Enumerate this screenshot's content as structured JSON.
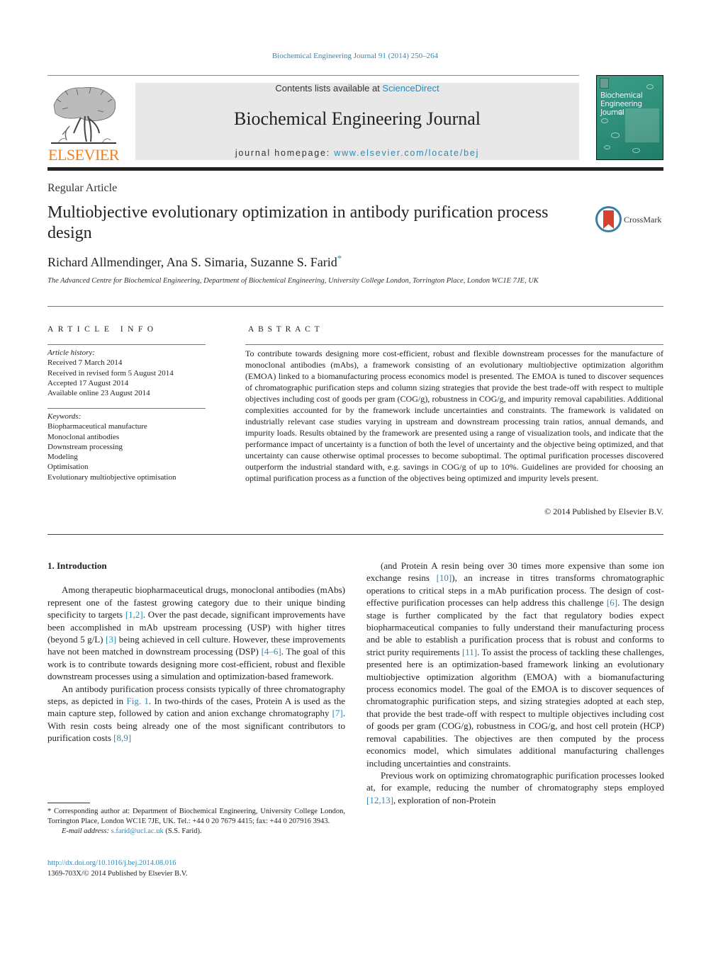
{
  "header": {
    "journal_reference": "Biochemical Engineering Journal 91 (2014) 250–264",
    "publisher_logo": {
      "icon": "elsevier-tree-icon",
      "wordmark": "ELSEVIER",
      "color": "#f07f1e"
    },
    "contents_prefix": "Contents lists available at ",
    "contents_link": "ScienceDirect",
    "journal_title": "Biochemical Engineering Journal",
    "homepage_prefix": "journal homepage: ",
    "homepage_link": "www.elsevier.com/locate/bej",
    "cover": {
      "icon": "journal-cover-image",
      "text_line1": "Biochemical",
      "text_line2": "Engineering",
      "text_line3": "Journal"
    },
    "link_color": "#2a8bb8"
  },
  "article": {
    "type": "Regular Article",
    "title": "Multiobjective evolutionary optimization in antibody purification process design",
    "crossmark_label": "CrossMark",
    "authors": "Richard Allmendinger, Ana S. Simaria, Suzanne S. Farid",
    "corresponding_marker": "*",
    "affiliation": "The Advanced Centre for Biochemical Engineering, Department of Biochemical Engineering, University College London, Torrington Place, London WC1E 7JE, UK"
  },
  "article_info": {
    "heading": "ARTICLE INFO",
    "history_label": "Article history:",
    "history": [
      "Received 7 March 2014",
      "Received in revised form 5 August 2014",
      "Accepted 17 August 2014",
      "Available online 23 August 2014"
    ],
    "keywords_label": "Keywords:",
    "keywords": [
      "Biopharmaceutical manufacture",
      "Monoclonal antibodies",
      "Downstream processing",
      "Modeling",
      "Optimisation",
      "Evolutionary multiobjective optimisation"
    ]
  },
  "abstract": {
    "heading": "ABSTRACT",
    "text": "To contribute towards designing more cost-efficient, robust and flexible downstream processes for the manufacture of monoclonal antibodies (mAbs), a framework consisting of an evolutionary multiobjective optimization algorithm (EMOA) linked to a biomanufacturing process economics model is presented. The EMOA is tuned to discover sequences of chromatographic purification steps and column sizing strategies that provide the best trade-off with respect to multiple objectives including cost of goods per gram (COG/g), robustness in COG/g, and impurity removal capabilities. Additional complexities accounted for by the framework include uncertainties and constraints. The framework is validated on industrially relevant case studies varying in upstream and downstream processing train ratios, annual demands, and impurity loads. Results obtained by the framework are presented using a range of visualization tools, and indicate that the performance impact of uncertainty is a function of both the level of uncertainty and the objective being optimized, and that uncertainty can cause otherwise optimal processes to become suboptimal. The optimal purification processes discovered outperform the industrial standard with, e.g. savings in COG/g of up to 10%. Guidelines are provided for choosing an optimal purification process as a function of the objectives being optimized and impurity levels present.",
    "copyright": "© 2014 Published by Elsevier B.V."
  },
  "body": {
    "section_heading": "1.  Introduction",
    "left_paragraphs": [
      [
        {
          "t": "Among therapeutic biopharmaceutical drugs, monoclonal antibodies (mAbs) represent one of the fastest growing category due to their unique binding specificity to targets "
        },
        {
          "t": "[1,2]",
          "link": true
        },
        {
          "t": ". Over the past decade, significant improvements have been accomplished in mAb upstream processing (USP) with higher titres (beyond 5 g/L) "
        },
        {
          "t": "[3]",
          "link": true
        },
        {
          "t": " being achieved in cell culture. However, these improvements have not been matched in downstream processing (DSP) "
        },
        {
          "t": "[4–6]",
          "link": true
        },
        {
          "t": ". The goal of this work is to contribute towards designing more cost-efficient, robust and flexible downstream processes using a simulation and optimization-based framework."
        }
      ],
      [
        {
          "t": "An antibody purification process consists typically of three chromatography steps, as depicted in "
        },
        {
          "t": "Fig. 1",
          "link": true
        },
        {
          "t": ". In two-thirds of the cases, Protein A is used as the main capture step, followed by cation and anion exchange chromatography "
        },
        {
          "t": "[7]",
          "link": true
        },
        {
          "t": ". With resin costs being already one of the most significant contributors to purification costs "
        },
        {
          "t": "[8,9]",
          "link": true
        }
      ]
    ],
    "right_paragraphs": [
      [
        {
          "t": "(and Protein A resin being over 30 times more expensive than some ion exchange resins "
        },
        {
          "t": "[10]",
          "link": true
        },
        {
          "t": "), an increase in titres transforms chromatographic operations to critical steps in a mAb purification process. The design of cost-effective purification processes can help address this challenge "
        },
        {
          "t": "[6]",
          "link": true
        },
        {
          "t": ". The design stage is further complicated by the fact that regulatory bodies expect biopharmaceutical companies to fully understand their manufacturing process and be able to establish a purification process that is robust and conforms to strict purity requirements "
        },
        {
          "t": "[11]",
          "link": true
        },
        {
          "t": ". To assist the process of tackling these challenges, presented here is an optimization-based framework linking an evolutionary multiobjective optimization algorithm (EMOA) with a biomanufacturing process economics model. The goal of the EMOA is to discover sequences of chromatographic purification steps, and sizing strategies adopted at each step, that provide the best trade-off with respect to multiple objectives including cost of goods per gram (COG/g), robustness in COG/g, and host cell protein (HCP) removal capabilities. The objectives are then computed by the process economics model, which simulates additional manufacturing challenges including uncertainties and constraints."
        }
      ],
      [
        {
          "t": "Previous work on optimizing chromatographic purification processes looked at, for example, reducing the number of chromatography steps employed "
        },
        {
          "t": "[12,13]",
          "link": true
        },
        {
          "t": ", exploration of non-Protein"
        }
      ]
    ]
  },
  "footnotes": {
    "corresponding": "* Corresponding author at: Department of Biochemical Engineering, University College London, Torrington Place, London WC1E 7JE, UK. Tel.: +44 0 20 7679 4415; fax: +44 0 207916 3943.",
    "email_label": "E-mail address:",
    "email": "s.farid@ucl.ac.uk",
    "email_suffix": " (S.S. Farid).",
    "doi_link": "http://dx.doi.org/10.1016/j.bej.2014.08.016",
    "issn_line": "1369-703X/© 2014 Published by Elsevier B.V."
  }
}
